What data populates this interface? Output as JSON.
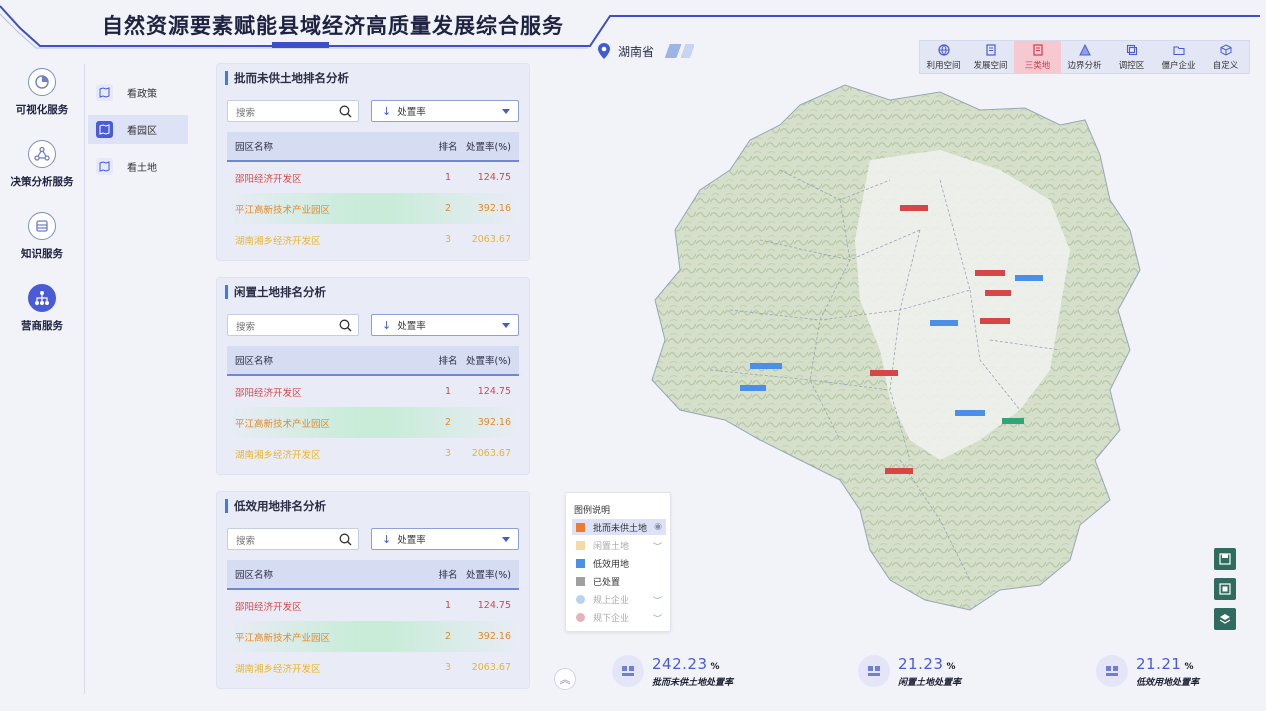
{
  "header": {
    "title": "自然资源要素赋能县域经济高质量发展综合服务",
    "region": "湖南省"
  },
  "leftnav": {
    "items": [
      {
        "label": "可视化服务",
        "icon": "chart-pie-icon"
      },
      {
        "label": "决策分析服务",
        "icon": "network-icon"
      },
      {
        "label": "知识服务",
        "icon": "book-icon"
      },
      {
        "label": "营商服务",
        "icon": "hierarchy-icon"
      }
    ],
    "active": 3
  },
  "subnav": {
    "items": [
      {
        "label": "看政策"
      },
      {
        "label": "看园区"
      },
      {
        "label": "看土地"
      }
    ],
    "active": 1
  },
  "panels": [
    {
      "title": "批而未供土地排名分析",
      "search_placeholder": "搜索",
      "sort_label": "处置率",
      "columns": [
        "园区名称",
        "排名",
        "处置率(%)"
      ],
      "rows": [
        {
          "name": "邵阳经济开发区",
          "rank": "1",
          "rate": "124.75"
        },
        {
          "name": "平江高新技术产业园区",
          "rank": "2",
          "rate": "392.16"
        },
        {
          "name": "湖南湘乡经济开发区",
          "rank": "3",
          "rate": "2063.67"
        }
      ]
    },
    {
      "title": "闲置土地排名分析",
      "search_placeholder": "搜索",
      "sort_label": "处置率",
      "columns": [
        "园区名称",
        "排名",
        "处置率(%)"
      ],
      "rows": [
        {
          "name": "邵阳经济开发区",
          "rank": "1",
          "rate": "124.75"
        },
        {
          "name": "平江高新技术产业园区",
          "rank": "2",
          "rate": "392.16"
        },
        {
          "name": "湖南湘乡经济开发区",
          "rank": "3",
          "rate": "2063.67"
        }
      ]
    },
    {
      "title": "低效用地排名分析",
      "search_placeholder": "搜索",
      "sort_label": "处置率",
      "columns": [
        "园区名称",
        "排名",
        "处置率(%)"
      ],
      "rows": [
        {
          "name": "邵阳经济开发区",
          "rank": "1",
          "rate": "124.75"
        },
        {
          "name": "平江高新技术产业园区",
          "rank": "2",
          "rate": "392.16"
        },
        {
          "name": "湖南湘乡经济开发区",
          "rank": "3",
          "rate": "2063.67"
        }
      ]
    }
  ],
  "toolbar": {
    "items": [
      {
        "label": "利用空间",
        "icon": "globe-icon"
      },
      {
        "label": "发展空间",
        "icon": "document-icon"
      },
      {
        "label": "三类地",
        "icon": "book-open-icon"
      },
      {
        "label": "边界分析",
        "icon": "triangle-icon"
      },
      {
        "label": "调控区",
        "icon": "layers-icon"
      },
      {
        "label": "僵户企业",
        "icon": "folder-icon"
      },
      {
        "label": "自定义",
        "icon": "cube-icon"
      }
    ],
    "active": 2,
    "active_color": "#d23a4e"
  },
  "legend": {
    "title": "图例说明",
    "items": [
      {
        "label": "批而未供土地",
        "color": "#f07a2e"
      },
      {
        "label": "闲置土地",
        "color": "#f6d9a6"
      },
      {
        "label": "低效用地",
        "color": "#4a8fe8"
      },
      {
        "label": "已处置",
        "color": "#a0a0a0"
      },
      {
        "label": "规上企业",
        "color": "#b9d2f2"
      },
      {
        "label": "规下企业",
        "color": "#e3b5b9"
      }
    ]
  },
  "stats": [
    {
      "value": "242.23",
      "unit": "%",
      "label": "批而未供土地处置率"
    },
    {
      "value": "21.23",
      "unit": "%",
      "label": "闲置土地处置率"
    },
    {
      "value": "21.21",
      "unit": "%",
      "label": "低效用地处置率"
    }
  ],
  "colors": {
    "accent": "#4a5bd6",
    "rank1": "#d64646",
    "rank2": "#e38a2a",
    "rank3": "#e8b52e"
  }
}
